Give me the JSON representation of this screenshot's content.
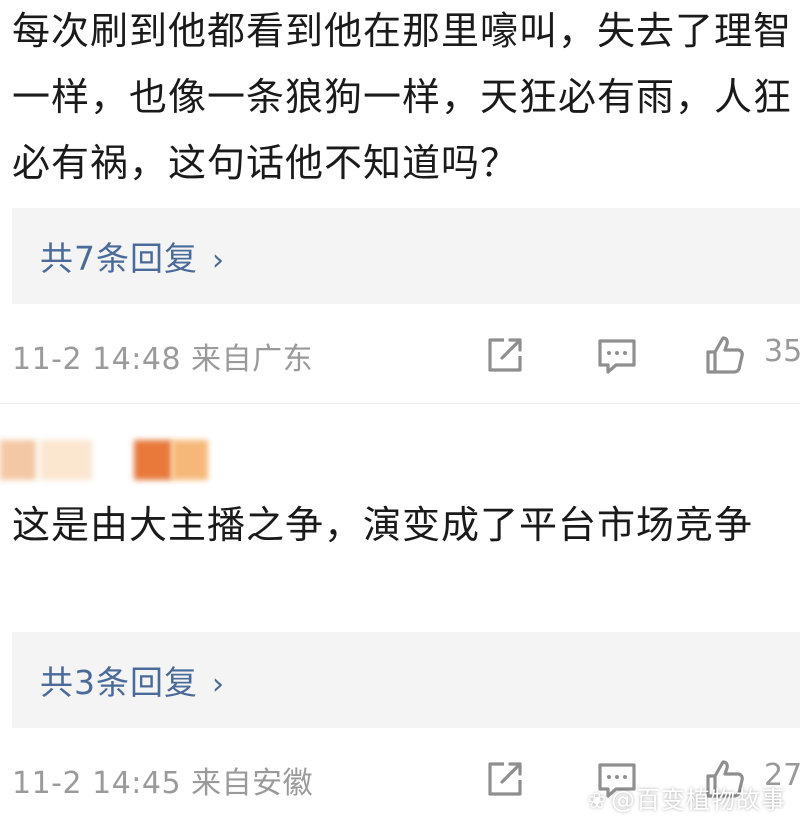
{
  "comments": [
    {
      "text": "每次刷到他都看到他在那里嚎叫，失去了理智一样，也像一条狼狗一样，天狂必有雨，人狂必有祸，这句话他不知道吗？",
      "replies_label": "共7条回复",
      "meta": "11-2 14:48 来自广东",
      "likes": "35"
    },
    {
      "text": "这是由大主播之争，演变成了平台市场竞争",
      "replies_label": "共3条回复",
      "meta": "11-2 14:45 来自安徽",
      "likes": "27"
    }
  ],
  "icons": {
    "share": "share-icon",
    "comment": "comment-icon",
    "like": "thumbs-up-icon",
    "chevron": "chevron-right-icon"
  },
  "colors": {
    "link": "#4a6b9a",
    "meta": "#9a9a9a",
    "reply_bg": "#f4f4f4",
    "icon": "#8f8f8f",
    "blurred_name": [
      "#f3c8a4",
      "#fbe6cf",
      "#e8793a",
      "#f6b878"
    ]
  },
  "watermark": "@百变植物故事"
}
